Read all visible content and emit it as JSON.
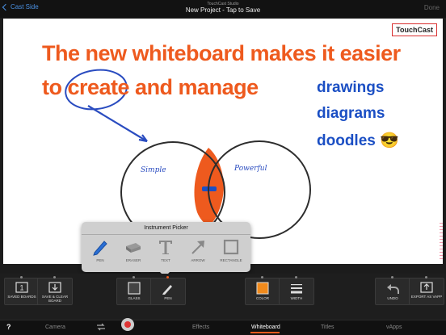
{
  "topbar": {
    "back_label": "Cast Side",
    "studio_label": "TouchCast Studio",
    "project_title": "New Project - Tap to Save",
    "done_label": "Done"
  },
  "whiteboard": {
    "logo": "TouchCast",
    "headline_line1": "The new whiteboard makes it easier",
    "headline_line2": "to create and manage",
    "side_items": [
      "drawings",
      "diagrams",
      "doodles 😎"
    ],
    "venn_left": "Simple",
    "venn_right": "Powerful"
  },
  "instrument_picker": {
    "title": "Instrument Picker",
    "tools": [
      "PEN",
      "ERASER",
      "TEXT",
      "ARROW",
      "RECTANGLE"
    ]
  },
  "toolbar": {
    "saved_boards": "SAVED BOARDS",
    "saved_boards_count": "1",
    "save_clear": "SAVE & CLEAR BOARD",
    "glass": "GLASS",
    "pen": "PEN",
    "color": "COLOR",
    "color_value": "#f08a1c",
    "width": "WIDTH",
    "undo": "UNDO",
    "export": "EXPORT AS VAPP"
  },
  "tabs": {
    "help": "?",
    "camera": "Camera",
    "effects": "Effects",
    "whiteboard": "Whiteboard",
    "titles": "Titles",
    "vapps": "vApps"
  }
}
